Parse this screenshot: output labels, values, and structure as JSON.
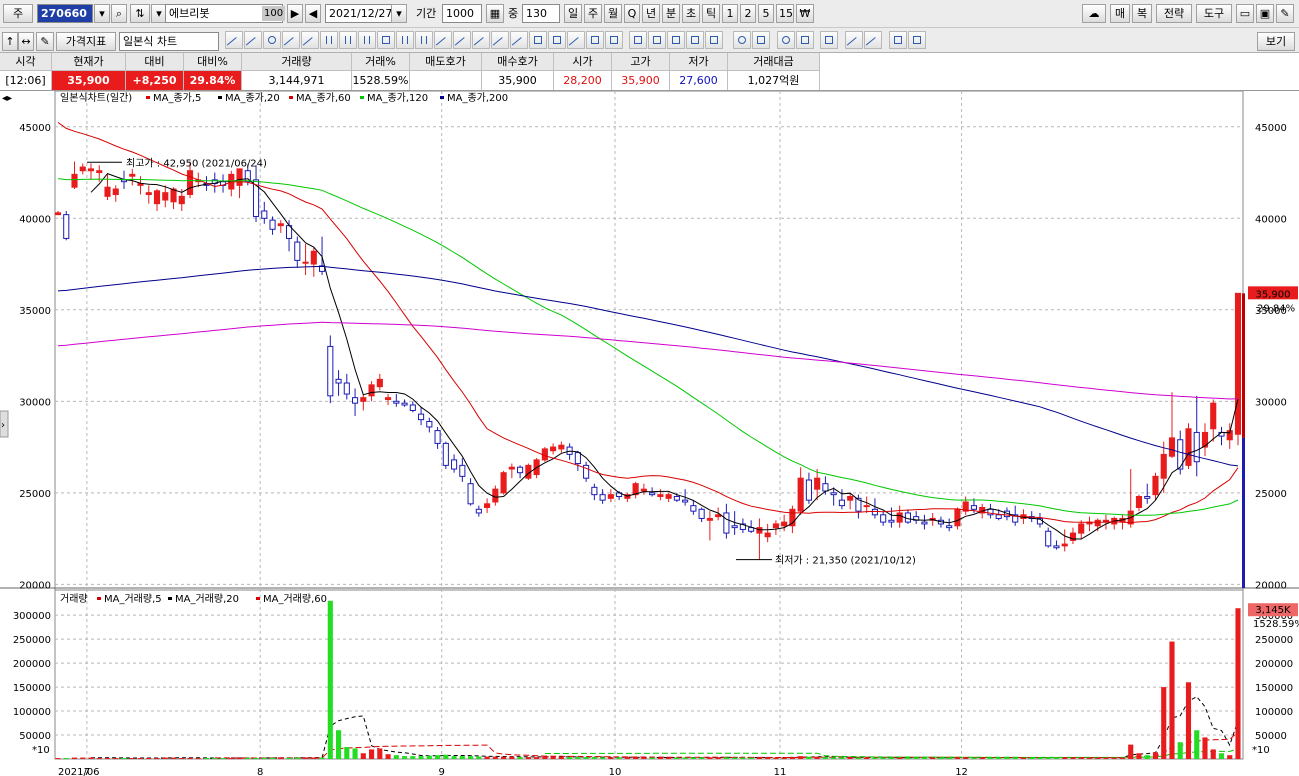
{
  "toolbar": {
    "mode_label": "주",
    "stock_code": "270660",
    "stock_name": "에브리봇",
    "zoom_badge": "100",
    "date": "2021/12/27",
    "period_label": "기간",
    "period_value": "1000",
    "count_label": "중",
    "count_value": "130",
    "periods": [
      "일",
      "주",
      "월",
      "Q",
      "년",
      "분",
      "초",
      "틱",
      "1",
      "2",
      "5",
      "15"
    ],
    "selected_period": "일",
    "right_buttons": [
      "매",
      "복",
      "전략",
      "도구"
    ],
    "indicator_button": "가격지표",
    "chart_type": "일본식 차트",
    "view_button": "보기"
  },
  "info": {
    "headers": [
      "시각",
      "현재가",
      "대비",
      "대비%",
      "거래량",
      "거래%",
      "매도호가",
      "매수호가",
      "시가",
      "고가",
      "저가",
      "거래대금"
    ],
    "values": [
      "[12:06]",
      "35,900",
      "+8,250",
      "29.84%",
      "3,144,971",
      "1528.59%",
      "",
      "35,900",
      "28,200",
      "35,900",
      "27,600",
      "1,027억원"
    ]
  },
  "chart_data": {
    "type": "candlestick",
    "price_legend_title": "일본식차트(일간)",
    "price_ma_labels": [
      "MA_종가,5",
      "MA_종가,20",
      "MA_종가,60",
      "MA_종가,120",
      "MA_종가,200"
    ],
    "volume_legend_title": "거래량",
    "volume_ma_labels": [
      "MA_거래량,5",
      "MA_거래량,20",
      "MA_거래량,60"
    ],
    "x_tick_labels": [
      "2021/06",
      "7",
      "8",
      "9",
      "10",
      "11",
      "12"
    ],
    "price_ticks": [
      45000,
      40000,
      35000,
      30000,
      25000,
      20000
    ],
    "volume_ticks": [
      300000,
      250000,
      200000,
      150000,
      100000,
      50000
    ],
    "volume_unit_label": "*10",
    "ylim_price": [
      19800,
      46300
    ],
    "ylim_volume": [
      0,
      340000
    ],
    "annotations": {
      "high": "최고가 : 42,950 (2021/06/24)",
      "low": "최저가 : 21,350 (2021/10/12)"
    },
    "last_price_label": "35,900",
    "last_change_label": "29.84%",
    "last_volume_label": "3,145K",
    "last_volume_pct_label": "1528.59%",
    "colors": {
      "up": "#e81c1c",
      "down": "#1c1cb4",
      "ma5": "#000000",
      "ma20": "#d80000",
      "ma60": "#00c800",
      "ma120": "#00008c",
      "ma200": "#d000d0",
      "grid": "#b8b8b8"
    },
    "month_start_index": [
      0,
      4,
      25,
      47,
      68,
      88,
      110
    ],
    "ohlc": [
      [
        40200,
        40400,
        40200,
        40300
      ],
      [
        40200,
        40400,
        38800,
        38900
      ],
      [
        41700,
        43100,
        41600,
        42400
      ],
      [
        42600,
        43000,
        42400,
        42800
      ],
      [
        42600,
        43000,
        42100,
        42700
      ],
      [
        42500,
        42900,
        42000,
        42600
      ],
      [
        41200,
        42400,
        41000,
        41700
      ],
      [
        41300,
        41800,
        40900,
        41600
      ],
      [
        42100,
        42600,
        41600,
        42000
      ],
      [
        42300,
        42700,
        41800,
        42400
      ],
      [
        41800,
        42300,
        41300,
        41900
      ],
      [
        41300,
        41800,
        40800,
        41400
      ],
      [
        40800,
        41600,
        40400,
        41500
      ],
      [
        41000,
        41800,
        40600,
        41400
      ],
      [
        40900,
        41700,
        40500,
        41600
      ],
      [
        40800,
        41600,
        40400,
        41200
      ],
      [
        41300,
        43100,
        41100,
        42600
      ],
      [
        42000,
        42500,
        41700,
        42100
      ],
      [
        41900,
        42300,
        41500,
        41800
      ],
      [
        42100,
        42500,
        41400,
        41900
      ],
      [
        42000,
        42400,
        41400,
        41800
      ],
      [
        41600,
        42600,
        41200,
        42400
      ],
      [
        41800,
        42600,
        41100,
        42700
      ],
      [
        42600,
        42950,
        41800,
        42000
      ],
      [
        42100,
        42900,
        39800,
        40100
      ],
      [
        40400,
        40900,
        39700,
        40000
      ],
      [
        39900,
        40100,
        39100,
        39400
      ],
      [
        39600,
        39900,
        39200,
        39700
      ],
      [
        39600,
        39900,
        38200,
        38900
      ],
      [
        38700,
        39000,
        37300,
        37700
      ],
      [
        37600,
        38600,
        36900,
        37600
      ],
      [
        37500,
        38400,
        36800,
        38200
      ],
      [
        37400,
        39000,
        36900,
        37100
      ],
      [
        33000,
        33600,
        29900,
        30300
      ],
      [
        31200,
        31700,
        30300,
        31000
      ],
      [
        31000,
        31500,
        30100,
        30400
      ],
      [
        30200,
        30700,
        29200,
        29900
      ],
      [
        30000,
        30400,
        29500,
        30200
      ],
      [
        30300,
        31100,
        30000,
        30900
      ],
      [
        30800,
        31500,
        30600,
        31200
      ],
      [
        30100,
        30400,
        29800,
        30200
      ],
      [
        30000,
        30400,
        29700,
        29900
      ],
      [
        29900,
        30100,
        29700,
        29800
      ],
      [
        29800,
        30000,
        29400,
        29500
      ],
      [
        29300,
        29700,
        28700,
        29000
      ],
      [
        28900,
        29100,
        28300,
        28600
      ],
      [
        28400,
        28600,
        27400,
        27700
      ],
      [
        27700,
        27800,
        26300,
        26500
      ],
      [
        26800,
        27100,
        26100,
        26300
      ],
      [
        26500,
        26900,
        25600,
        25900
      ],
      [
        25500,
        25800,
        24300,
        24400
      ],
      [
        24100,
        24300,
        23700,
        23900
      ],
      [
        24200,
        24700,
        23900,
        24400
      ],
      [
        24500,
        25400,
        24300,
        25200
      ],
      [
        25000,
        26200,
        24900,
        26100
      ],
      [
        26300,
        26600,
        25800,
        26400
      ],
      [
        26400,
        26500,
        25800,
        26100
      ],
      [
        25800,
        26600,
        25700,
        26500
      ],
      [
        26000,
        26900,
        25800,
        26800
      ],
      [
        26800,
        27500,
        26700,
        27400
      ],
      [
        27300,
        27700,
        27100,
        27500
      ],
      [
        27400,
        27800,
        27200,
        27600
      ],
      [
        27500,
        27700,
        26800,
        27100
      ],
      [
        27200,
        27300,
        26200,
        26600
      ],
      [
        26500,
        26700,
        25600,
        25800
      ],
      [
        25300,
        25500,
        24600,
        24900
      ],
      [
        24900,
        25200,
        24400,
        24600
      ],
      [
        24700,
        25200,
        24500,
        24900
      ],
      [
        25000,
        25100,
        24600,
        24800
      ],
      [
        24700,
        25000,
        24500,
        24900
      ],
      [
        24900,
        25600,
        24700,
        25500
      ],
      [
        25100,
        25500,
        24900,
        25200
      ],
      [
        25000,
        25300,
        24800,
        24900
      ],
      [
        24800,
        25200,
        24600,
        24900
      ],
      [
        24700,
        25000,
        24500,
        24900
      ],
      [
        24800,
        25000,
        24500,
        24600
      ],
      [
        24600,
        25200,
        24300,
        24500
      ],
      [
        24300,
        24600,
        23800,
        24000
      ],
      [
        24100,
        24200,
        23400,
        23600
      ],
      [
        23500,
        24000,
        22400,
        23600
      ],
      [
        23700,
        24200,
        23500,
        23800
      ],
      [
        23900,
        24400,
        22500,
        22800
      ],
      [
        23200,
        24000,
        22700,
        23100
      ],
      [
        23300,
        23600,
        22800,
        23000
      ],
      [
        23100,
        23500,
        22800,
        22900
      ],
      [
        22800,
        23600,
        21350,
        23100
      ],
      [
        22600,
        23300,
        22300,
        22800
      ],
      [
        23100,
        23500,
        22700,
        23300
      ],
      [
        23200,
        23800,
        22900,
        23400
      ],
      [
        23200,
        24300,
        22800,
        24100
      ],
      [
        24000,
        26400,
        23800,
        25800
      ],
      [
        25700,
        26100,
        24400,
        24600
      ],
      [
        25200,
        26300,
        24600,
        25800
      ],
      [
        25500,
        25900,
        24900,
        25100
      ],
      [
        25000,
        25300,
        24300,
        24900
      ],
      [
        24600,
        25200,
        24100,
        24300
      ],
      [
        24600,
        25000,
        24100,
        24800
      ],
      [
        24700,
        24900,
        23600,
        24000
      ],
      [
        24300,
        24800,
        23900,
        24300
      ],
      [
        24100,
        24700,
        23600,
        23800
      ],
      [
        23800,
        24000,
        23200,
        23400
      ],
      [
        23500,
        24200,
        23100,
        23400
      ],
      [
        23400,
        24300,
        23100,
        23900
      ],
      [
        23900,
        24100,
        23300,
        23400
      ],
      [
        23700,
        24000,
        23300,
        23500
      ],
      [
        23400,
        23800,
        23000,
        23300
      ],
      [
        23500,
        23900,
        23200,
        23600
      ],
      [
        23500,
        23700,
        23100,
        23300
      ],
      [
        23200,
        23600,
        22900,
        23100
      ],
      [
        23200,
        24200,
        23000,
        24100
      ],
      [
        24000,
        24800,
        23800,
        24500
      ],
      [
        24300,
        24700,
        23900,
        24100
      ],
      [
        23900,
        24400,
        23600,
        24200
      ],
      [
        24100,
        24400,
        23600,
        23800
      ],
      [
        23800,
        24100,
        23500,
        23600
      ],
      [
        24000,
        24200,
        23500,
        23700
      ],
      [
        23800,
        24300,
        23200,
        23400
      ],
      [
        23600,
        24100,
        23300,
        23800
      ],
      [
        23700,
        24000,
        23400,
        23600
      ],
      [
        23600,
        23900,
        23100,
        23300
      ],
      [
        22900,
        23100,
        22000,
        22100
      ],
      [
        22100,
        22400,
        21900,
        22000
      ],
      [
        22100,
        23000,
        21800,
        22200
      ],
      [
        22400,
        23100,
        22200,
        22800
      ],
      [
        22800,
        23500,
        22500,
        23300
      ],
      [
        23300,
        23700,
        22900,
        23400
      ],
      [
        23200,
        23600,
        22900,
        23500
      ],
      [
        23400,
        23800,
        23000,
        23500
      ],
      [
        23300,
        23700,
        23000,
        23600
      ],
      [
        23400,
        23800,
        23000,
        23600
      ],
      [
        23300,
        26300,
        23100,
        24000
      ],
      [
        24200,
        24900,
        24000,
        24800
      ],
      [
        24800,
        25500,
        24400,
        24700
      ],
      [
        24900,
        26100,
        24600,
        25900
      ],
      [
        25800,
        27800,
        25000,
        27100
      ],
      [
        27000,
        30500,
        26900,
        28000
      ],
      [
        27900,
        28400,
        26000,
        26300
      ],
      [
        26500,
        28800,
        26300,
        28500
      ],
      [
        28300,
        30300,
        25900,
        26700
      ],
      [
        27500,
        28800,
        27000,
        28300
      ],
      [
        28500,
        30100,
        27800,
        29900
      ],
      [
        28300,
        28600,
        27600,
        28100
      ],
      [
        27900,
        28800,
        27400,
        28400
      ],
      [
        28200,
        35900,
        27600,
        35900
      ]
    ],
    "volume": [
      2000,
      2000,
      3000,
      3000,
      3000,
      2000,
      2000,
      2000,
      2000,
      2000,
      2000,
      2000,
      2000,
      3000,
      3000,
      2000,
      2500,
      2000,
      2000,
      2000,
      2000,
      2000,
      2000,
      2500,
      2000,
      2500,
      2500,
      2000,
      2500,
      3000,
      3000,
      3000,
      3000,
      330000,
      60000,
      25000,
      22000,
      12000,
      20000,
      22000,
      10000,
      8000,
      6000,
      6000,
      6000,
      7000,
      8000,
      9000,
      6000,
      6000,
      6000,
      5000,
      5000,
      5000,
      5000,
      5000,
      4000,
      4000,
      4000,
      5000,
      5000,
      4000,
      4000,
      4000,
      4000,
      4000,
      3500,
      3500,
      3500,
      3500,
      3500,
      3000,
      3000,
      3000,
      3000,
      3000,
      3000,
      3500,
      3500,
      3500,
      3500,
      3500,
      3000,
      3000,
      3000,
      3500,
      3000,
      3000,
      3000,
      4000,
      6000,
      5000,
      4500,
      4000,
      3500,
      3500,
      3500,
      3000,
      3000,
      3000,
      3000,
      3000,
      3000,
      3000,
      3000,
      3000,
      3000,
      3000,
      3000,
      3500,
      3500,
      3000,
      3000,
      3000,
      3000,
      3000,
      3000,
      3000,
      3000,
      3000,
      3500,
      3500,
      3000,
      3000,
      3000,
      3000,
      3000,
      3000,
      3000,
      3000,
      30000,
      12000,
      8000,
      14000,
      150000,
      245000,
      35000,
      160000,
      60000,
      45000,
      20000,
      12000,
      8000,
      314497
    ]
  }
}
